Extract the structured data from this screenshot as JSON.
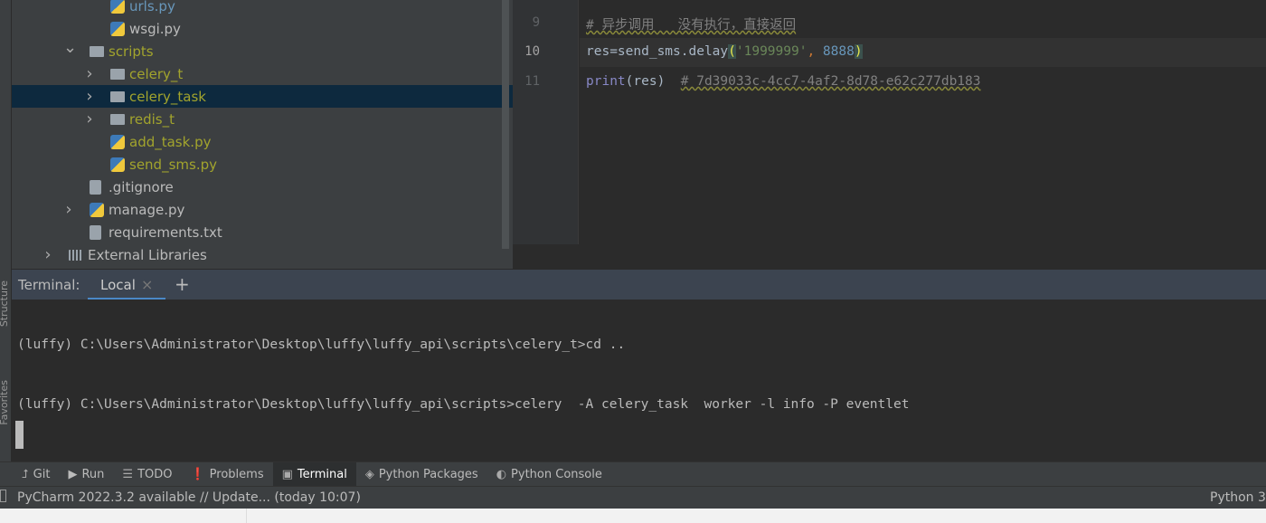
{
  "side_labels": [
    "Structure",
    "Favorites"
  ],
  "tree": [
    {
      "label": "urls.py",
      "type": "py",
      "indent": 3,
      "color": "blue"
    },
    {
      "label": "wsgi.py",
      "type": "py",
      "indent": 3,
      "color": "normal"
    },
    {
      "label": "scripts",
      "type": "folder",
      "indent": 2,
      "expanded": true,
      "color": "yel"
    },
    {
      "label": "celery_t",
      "type": "folder",
      "indent": 3,
      "collapsed": true,
      "color": "yel"
    },
    {
      "label": "celery_task",
      "type": "package",
      "indent": 3,
      "collapsed": true,
      "color": "yel",
      "selected": true
    },
    {
      "label": "redis_t",
      "type": "folder",
      "indent": 3,
      "collapsed": true,
      "color": "yel"
    },
    {
      "label": "add_task.py",
      "type": "py",
      "indent": 3,
      "color": "yel"
    },
    {
      "label": "send_sms.py",
      "type": "py",
      "indent": 3,
      "color": "yel"
    },
    {
      "label": ".gitignore",
      "type": "file",
      "indent": 2,
      "color": "normal"
    },
    {
      "label": "manage.py",
      "type": "py",
      "indent": 2,
      "collapsed": true,
      "color": "normal"
    },
    {
      "label": "requirements.txt",
      "type": "file",
      "indent": 2,
      "color": "normal"
    },
    {
      "label": "External Libraries",
      "type": "lib",
      "indent": 1,
      "collapsed": true,
      "color": "normal"
    }
  ],
  "editor": {
    "line_numbers": [
      "9",
      "10",
      "11"
    ],
    "line9": "# 异步调用   没有执行，直接返回",
    "l10": {
      "a": "res=send_sms.delay",
      "p1": "(",
      "s": "'1999999'",
      "c": ",",
      "n": " 8888",
      "p2": ")"
    },
    "l11": {
      "kw": "print",
      "b": "(res)  ",
      "cmt": "# 7d39033c-4cc7-4af2-8d78-e62c277db183"
    }
  },
  "terminal": {
    "label": "Terminal:",
    "tab": "Local",
    "close": "×",
    "add": "+",
    "lines": [
      "(luffy) C:\\Users\\Administrator\\Desktop\\luffy\\luffy_api\\scripts\\celery_t>cd ..",
      "(luffy) C:\\Users\\Administrator\\Desktop\\luffy\\luffy_api\\scripts>celery  -A celery_task  worker -l info -P eventlet"
    ]
  },
  "toolwindows": [
    {
      "label": "Git",
      "icon": "git-icon",
      "glyph": "⮥"
    },
    {
      "label": "Run",
      "icon": "run-icon",
      "glyph": "▶"
    },
    {
      "label": "TODO",
      "icon": "todo-icon",
      "glyph": "☰"
    },
    {
      "label": "Problems",
      "icon": "problems-icon",
      "glyph": "❗"
    },
    {
      "label": "Terminal",
      "icon": "terminal-icon",
      "glyph": "▣",
      "active": true
    },
    {
      "label": "Python Packages",
      "icon": "layers-icon",
      "glyph": "◈"
    },
    {
      "label": "Python Console",
      "icon": "python-icon",
      "glyph": "◐"
    }
  ],
  "status": {
    "message": "PyCharm 2022.3.2 available // Update... (today 10:07)",
    "interpreter": "Python 3"
  },
  "colors": {
    "selection": "#0d293e",
    "accent": "#4a88c7",
    "modified": "#a2a42d"
  }
}
